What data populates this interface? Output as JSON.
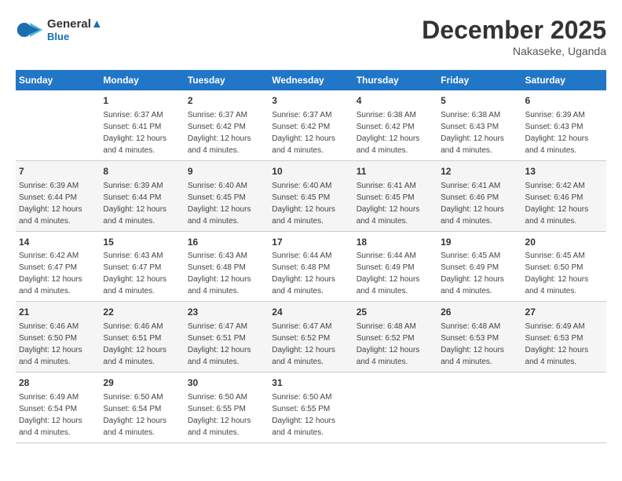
{
  "header": {
    "logo_line1": "General",
    "logo_line2": "Blue",
    "month": "December 2025",
    "location": "Nakaseke, Uganda"
  },
  "days_of_week": [
    "Sunday",
    "Monday",
    "Tuesday",
    "Wednesday",
    "Thursday",
    "Friday",
    "Saturday"
  ],
  "weeks": [
    [
      {
        "day": "",
        "info": ""
      },
      {
        "day": "1",
        "info": "Sunrise: 6:37 AM\nSunset: 6:41 PM\nDaylight: 12 hours\nand 4 minutes."
      },
      {
        "day": "2",
        "info": "Sunrise: 6:37 AM\nSunset: 6:42 PM\nDaylight: 12 hours\nand 4 minutes."
      },
      {
        "day": "3",
        "info": "Sunrise: 6:37 AM\nSunset: 6:42 PM\nDaylight: 12 hours\nand 4 minutes."
      },
      {
        "day": "4",
        "info": "Sunrise: 6:38 AM\nSunset: 6:42 PM\nDaylight: 12 hours\nand 4 minutes."
      },
      {
        "day": "5",
        "info": "Sunrise: 6:38 AM\nSunset: 6:43 PM\nDaylight: 12 hours\nand 4 minutes."
      },
      {
        "day": "6",
        "info": "Sunrise: 6:39 AM\nSunset: 6:43 PM\nDaylight: 12 hours\nand 4 minutes."
      }
    ],
    [
      {
        "day": "7",
        "info": "Sunrise: 6:39 AM\nSunset: 6:44 PM\nDaylight: 12 hours\nand 4 minutes."
      },
      {
        "day": "8",
        "info": "Sunrise: 6:39 AM\nSunset: 6:44 PM\nDaylight: 12 hours\nand 4 minutes."
      },
      {
        "day": "9",
        "info": "Sunrise: 6:40 AM\nSunset: 6:45 PM\nDaylight: 12 hours\nand 4 minutes."
      },
      {
        "day": "10",
        "info": "Sunrise: 6:40 AM\nSunset: 6:45 PM\nDaylight: 12 hours\nand 4 minutes."
      },
      {
        "day": "11",
        "info": "Sunrise: 6:41 AM\nSunset: 6:45 PM\nDaylight: 12 hours\nand 4 minutes."
      },
      {
        "day": "12",
        "info": "Sunrise: 6:41 AM\nSunset: 6:46 PM\nDaylight: 12 hours\nand 4 minutes."
      },
      {
        "day": "13",
        "info": "Sunrise: 6:42 AM\nSunset: 6:46 PM\nDaylight: 12 hours\nand 4 minutes."
      }
    ],
    [
      {
        "day": "14",
        "info": "Sunrise: 6:42 AM\nSunset: 6:47 PM\nDaylight: 12 hours\nand 4 minutes."
      },
      {
        "day": "15",
        "info": "Sunrise: 6:43 AM\nSunset: 6:47 PM\nDaylight: 12 hours\nand 4 minutes."
      },
      {
        "day": "16",
        "info": "Sunrise: 6:43 AM\nSunset: 6:48 PM\nDaylight: 12 hours\nand 4 minutes."
      },
      {
        "day": "17",
        "info": "Sunrise: 6:44 AM\nSunset: 6:48 PM\nDaylight: 12 hours\nand 4 minutes."
      },
      {
        "day": "18",
        "info": "Sunrise: 6:44 AM\nSunset: 6:49 PM\nDaylight: 12 hours\nand 4 minutes."
      },
      {
        "day": "19",
        "info": "Sunrise: 6:45 AM\nSunset: 6:49 PM\nDaylight: 12 hours\nand 4 minutes."
      },
      {
        "day": "20",
        "info": "Sunrise: 6:45 AM\nSunset: 6:50 PM\nDaylight: 12 hours\nand 4 minutes."
      }
    ],
    [
      {
        "day": "21",
        "info": "Sunrise: 6:46 AM\nSunset: 6:50 PM\nDaylight: 12 hours\nand 4 minutes."
      },
      {
        "day": "22",
        "info": "Sunrise: 6:46 AM\nSunset: 6:51 PM\nDaylight: 12 hours\nand 4 minutes."
      },
      {
        "day": "23",
        "info": "Sunrise: 6:47 AM\nSunset: 6:51 PM\nDaylight: 12 hours\nand 4 minutes."
      },
      {
        "day": "24",
        "info": "Sunrise: 6:47 AM\nSunset: 6:52 PM\nDaylight: 12 hours\nand 4 minutes."
      },
      {
        "day": "25",
        "info": "Sunrise: 6:48 AM\nSunset: 6:52 PM\nDaylight: 12 hours\nand 4 minutes."
      },
      {
        "day": "26",
        "info": "Sunrise: 6:48 AM\nSunset: 6:53 PM\nDaylight: 12 hours\nand 4 minutes."
      },
      {
        "day": "27",
        "info": "Sunrise: 6:49 AM\nSunset: 6:53 PM\nDaylight: 12 hours\nand 4 minutes."
      }
    ],
    [
      {
        "day": "28",
        "info": "Sunrise: 6:49 AM\nSunset: 6:54 PM\nDaylight: 12 hours\nand 4 minutes."
      },
      {
        "day": "29",
        "info": "Sunrise: 6:50 AM\nSunset: 6:54 PM\nDaylight: 12 hours\nand 4 minutes."
      },
      {
        "day": "30",
        "info": "Sunrise: 6:50 AM\nSunset: 6:55 PM\nDaylight: 12 hours\nand 4 minutes."
      },
      {
        "day": "31",
        "info": "Sunrise: 6:50 AM\nSunset: 6:55 PM\nDaylight: 12 hours\nand 4 minutes."
      },
      {
        "day": "",
        "info": ""
      },
      {
        "day": "",
        "info": ""
      },
      {
        "day": "",
        "info": ""
      }
    ]
  ]
}
